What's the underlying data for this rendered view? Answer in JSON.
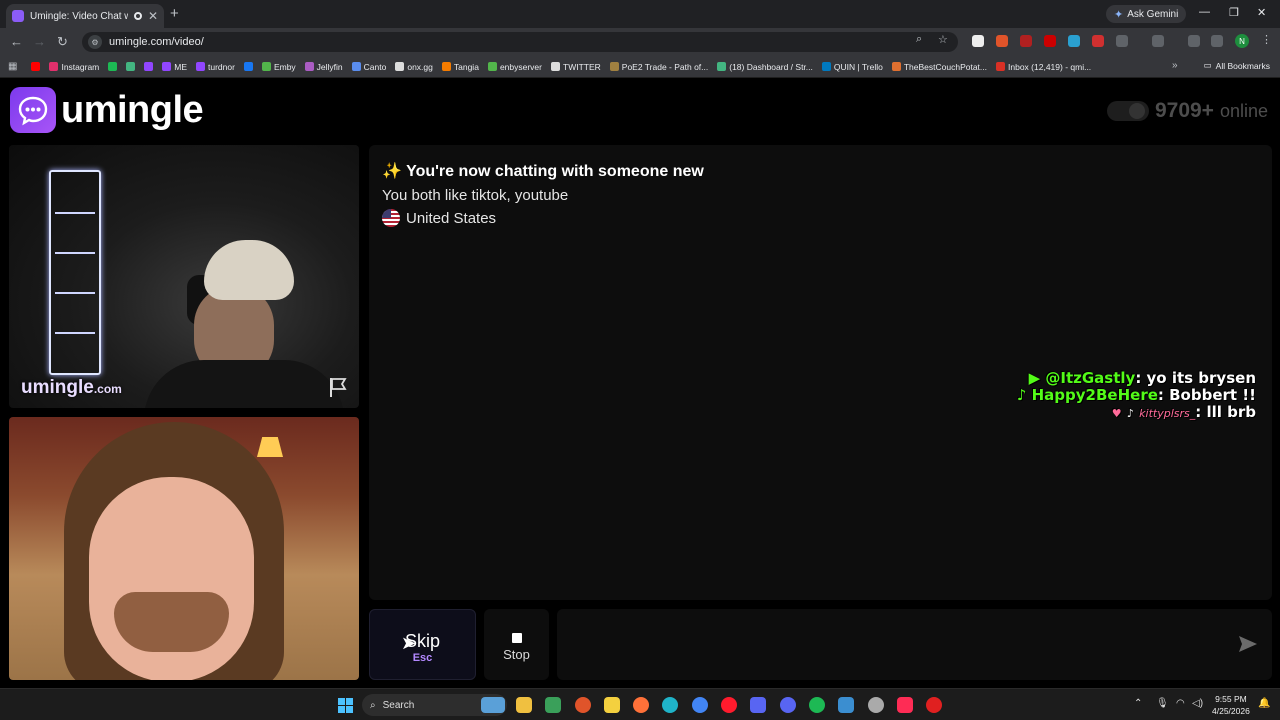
{
  "browser": {
    "tab_title": "Umingle: Video Chat with S",
    "new_tab_symbol": "+",
    "ask_gemini": "Ask Gemini",
    "url": "umingle.com/video/",
    "profile_initial": "N",
    "bookmarks": [
      {
        "label": "",
        "color": "#ff0000"
      },
      {
        "label": "Instagram",
        "color": "#e1306c"
      },
      {
        "label": "",
        "color": "#1db954"
      },
      {
        "label": "",
        "color": "#43b581"
      },
      {
        "label": "",
        "color": "#9146ff"
      },
      {
        "label": "ME",
        "color": "#9146ff"
      },
      {
        "label": "turdnor",
        "color": "#9146ff"
      },
      {
        "label": "",
        "color": "#1877f2"
      },
      {
        "label": "Emby",
        "color": "#52b54b"
      },
      {
        "label": "Jellyfin",
        "color": "#aa5cc3"
      },
      {
        "label": "Canto",
        "color": "#5a8dee"
      },
      {
        "label": "onx.gg",
        "color": "#dddddd"
      },
      {
        "label": "Tangia",
        "color": "#f57c00"
      },
      {
        "label": "enbyserver",
        "color": "#52b54b"
      },
      {
        "label": "TWITTER",
        "color": "#dddddd"
      },
      {
        "label": "PoE2 Trade - Path of...",
        "color": "#a08040"
      },
      {
        "label": "(18) Dashboard / Str...",
        "color": "#43b581"
      },
      {
        "label": "QUIN | Trello",
        "color": "#0079bf"
      },
      {
        "label": "TheBestCouchPotat...",
        "color": "#e07030"
      },
      {
        "label": "Inbox (12,419) - qmi...",
        "color": "#d93025"
      }
    ],
    "all_bookmarks": "All Bookmarks"
  },
  "site": {
    "logo_text": "umingle",
    "online_count": "9709+",
    "online_label": "online"
  },
  "video": {
    "watermark_main": "umingle",
    "watermark_suffix": ".com"
  },
  "chat": {
    "intro_icon": "✨",
    "intro": "You're now chatting with someone new",
    "common_interests": "You both like tiktok, youtube",
    "country": "United States"
  },
  "stream_overlay": [
    {
      "platform_icon": "youtube-icon",
      "user": "@ItzGastly",
      "message": ": yo its brysen"
    },
    {
      "platform_icon": "tiktok-icon",
      "user": "Happy2BeHere",
      "message": ": Bobbert !!"
    },
    {
      "platform_icon": "tiktok-icon",
      "user": "kittyplsrs_",
      "message": ": lll brb"
    }
  ],
  "controls": {
    "skip_label": "Skip",
    "skip_key": "Esc",
    "stop_label": "Stop",
    "message_placeholder": ""
  },
  "taskbar": {
    "search_label": "Search",
    "time": "9:55 PM",
    "date": "4/25/2026"
  },
  "colors": {
    "brand": "#8b5cf6",
    "overlay_green": "#53fc18"
  }
}
